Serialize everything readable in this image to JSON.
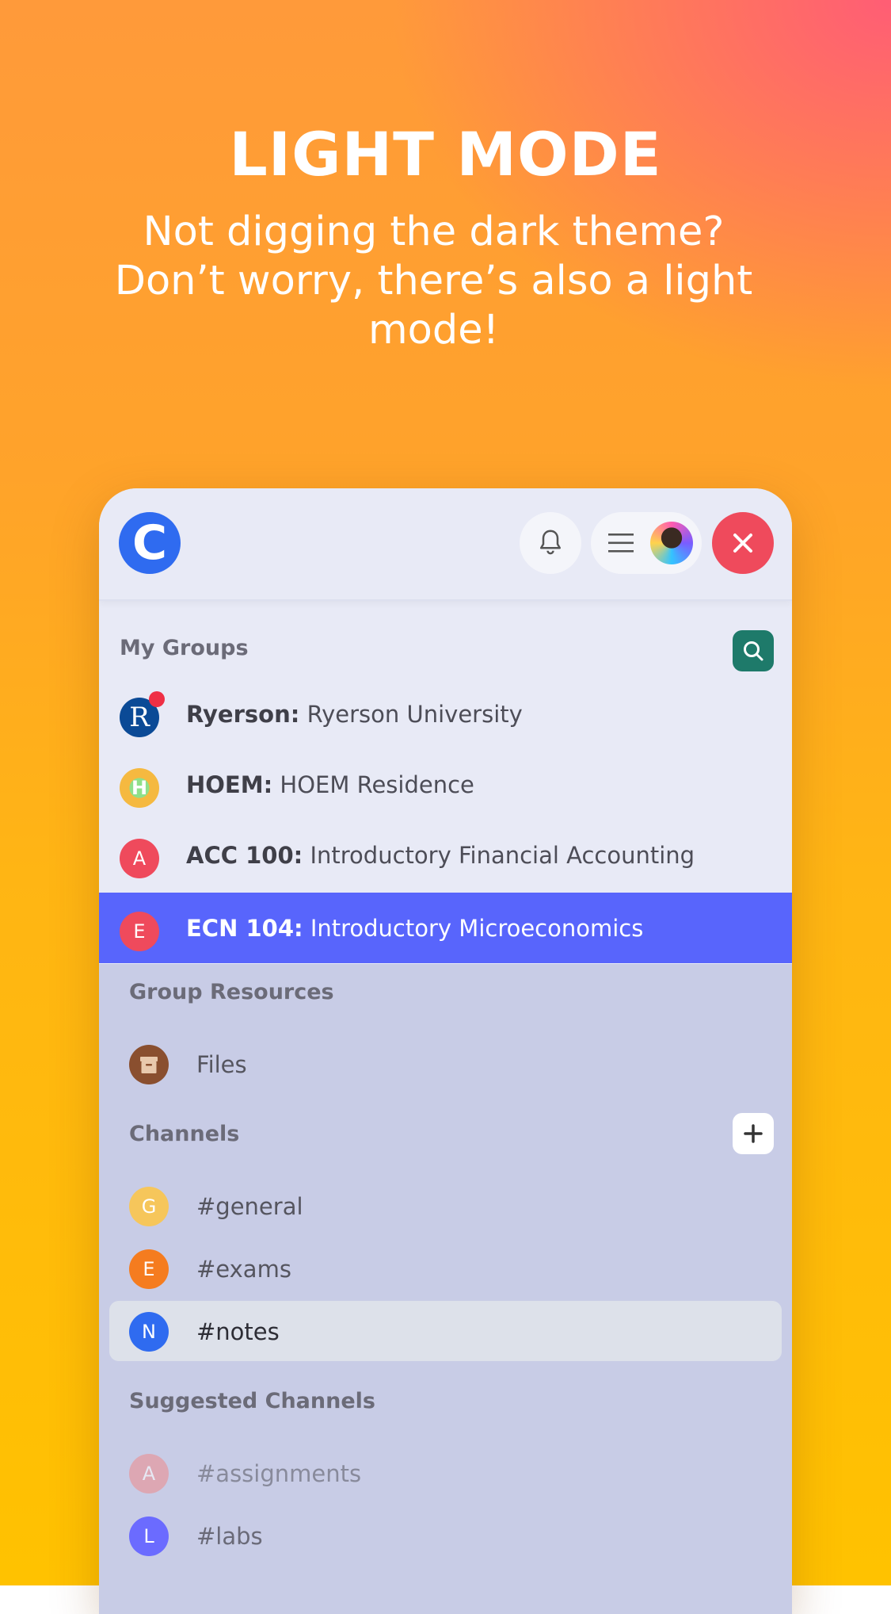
{
  "hero": {
    "title": "LIGHT MODE",
    "subtitle": "Not digging the dark theme? Don’t worry, there’s also a light mode!"
  },
  "topbar": {
    "logo_letter": "C",
    "icons": [
      "bell-icon",
      "menu-icon",
      "avatar",
      "close-icon"
    ]
  },
  "my_groups": {
    "label": "My Groups",
    "items": [
      {
        "badge": "R",
        "code": "Ryerson:",
        "name": "Ryerson University",
        "color": "#0b4a96",
        "notification": true
      },
      {
        "badge": "H",
        "code": "HOEM:",
        "name": "HOEM Residence",
        "color": "#f5b940"
      },
      {
        "badge": "A",
        "code": "ACC 100:",
        "name": "Introductory Financial Accounting",
        "color": "#ef4a5c"
      },
      {
        "badge": "E",
        "code": "ECN 104:",
        "name": "Introductory Microeconomics",
        "color": "#ef4a5c",
        "active": true
      }
    ]
  },
  "group_resources": {
    "label": "Group Resources",
    "items": [
      {
        "name": "Files",
        "icon": "archive-icon",
        "color": "#8a4f2f"
      }
    ]
  },
  "channels": {
    "label": "Channels",
    "items": [
      {
        "badge": "G",
        "name": "#general",
        "color": "#f6c65b"
      },
      {
        "badge": "E",
        "name": "#exams",
        "color": "#f57c1f"
      },
      {
        "badge": "N",
        "name": "#notes",
        "color": "#2f6bf0",
        "selected": true
      }
    ]
  },
  "suggested_channels": {
    "label": "Suggested Channels",
    "items": [
      {
        "badge": "A",
        "name": "#assignments",
        "color": "#ef8a8a"
      },
      {
        "badge": "L",
        "name": "#labs",
        "color": "#6b6bff"
      }
    ]
  },
  "colors": {
    "accent": "#5865fc",
    "close": "#ef4a5c",
    "search": "#1e7a6a"
  }
}
